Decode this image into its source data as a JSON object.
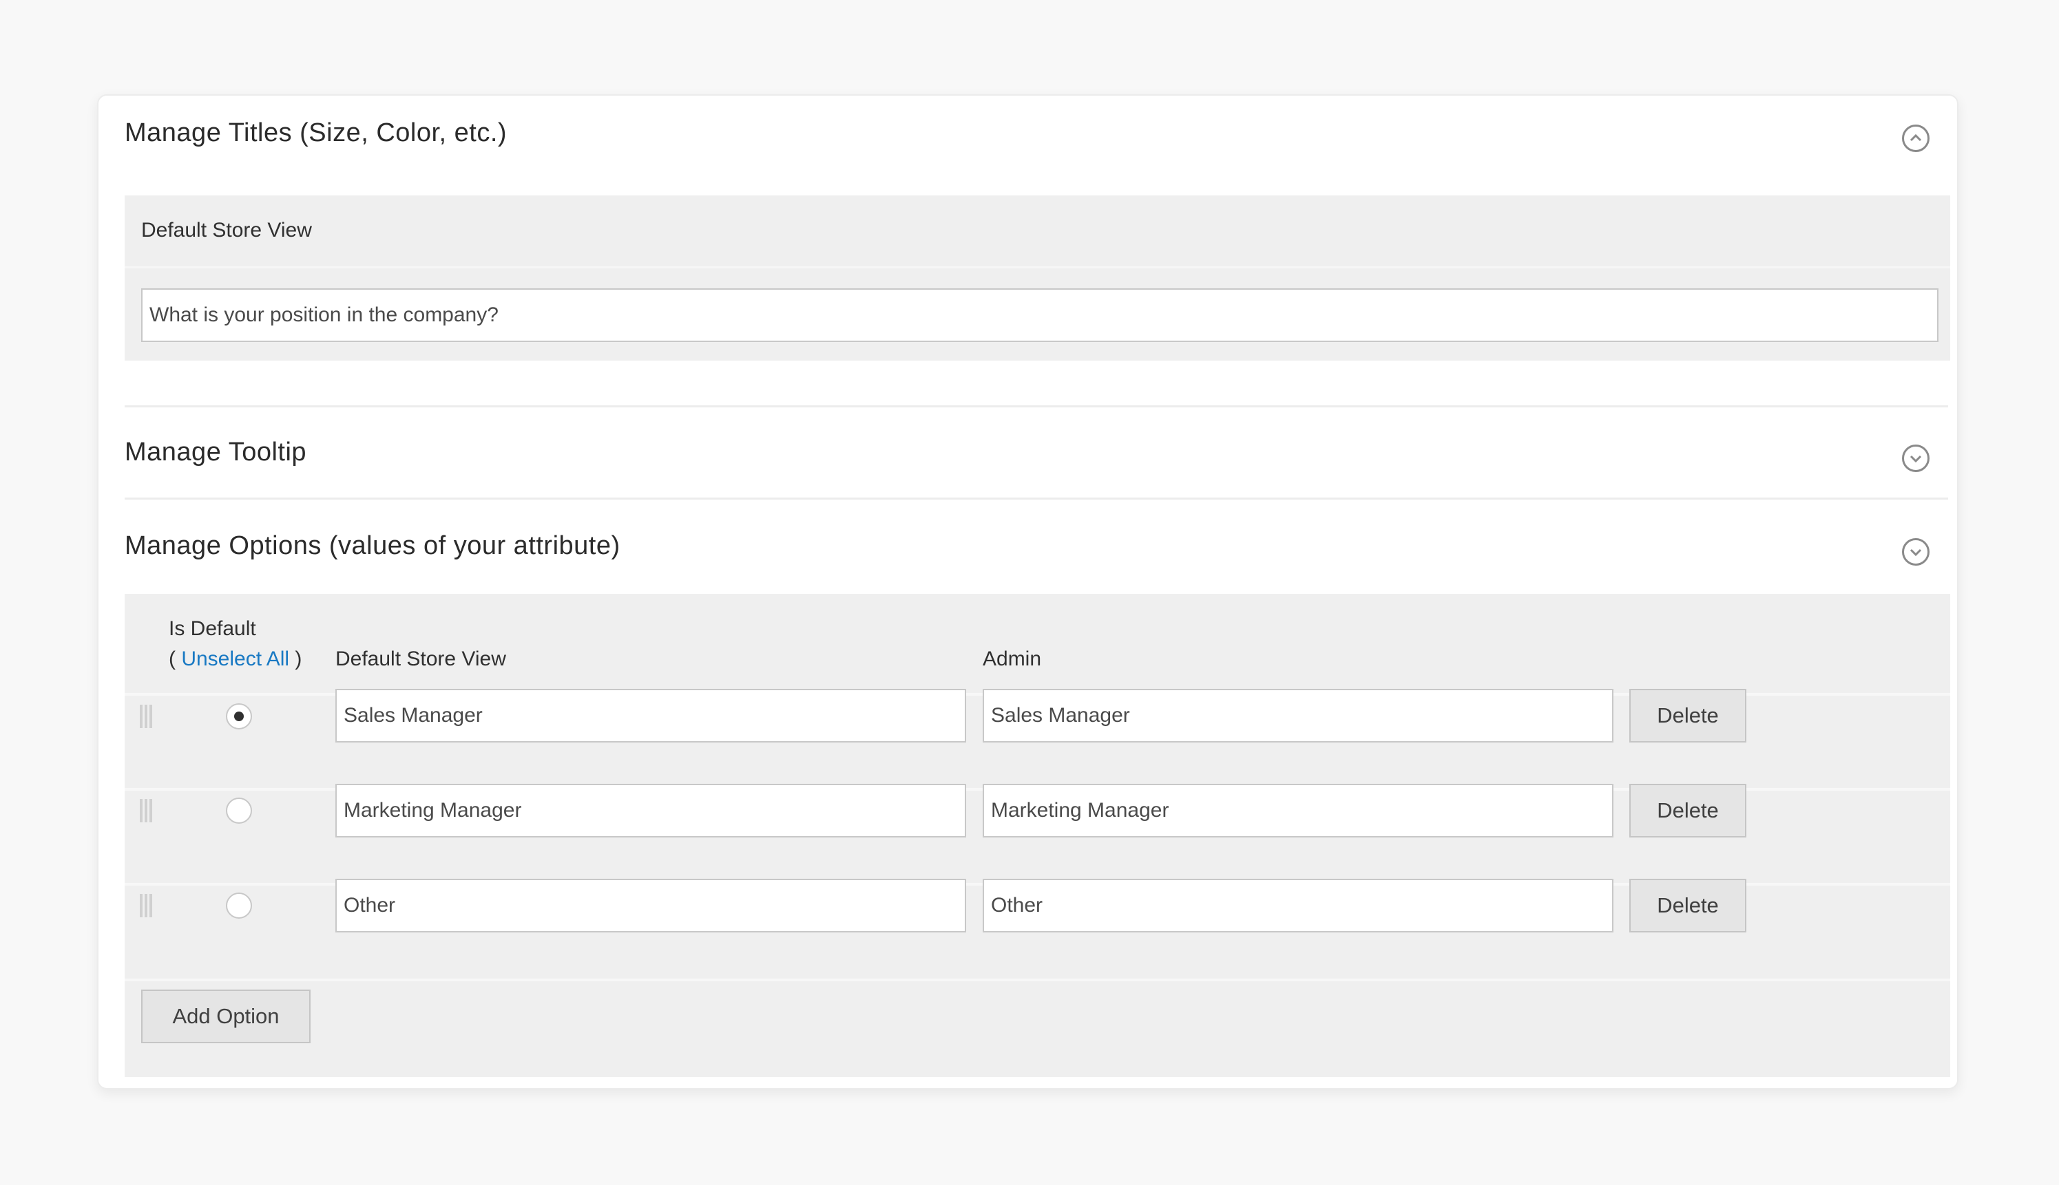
{
  "titles_section": {
    "heading": "Manage Titles (Size, Color, etc.)",
    "store_view_label": "Default Store View",
    "title_value": "What is your position in the company?"
  },
  "tooltip_section": {
    "heading": "Manage Tooltip"
  },
  "options_section": {
    "heading": "Manage Options (values of your attribute)",
    "headers": {
      "is_default": "Is Default",
      "unselect_open": "( ",
      "unselect_link": "Unselect All",
      "unselect_close": " )",
      "store_view": "Default Store View",
      "admin": "Admin"
    },
    "rows": [
      {
        "is_default": true,
        "store_view": "Sales Manager",
        "admin": "Sales Manager",
        "delete_label": "Delete"
      },
      {
        "is_default": false,
        "store_view": "Marketing Manager",
        "admin": "Marketing Manager",
        "delete_label": "Delete"
      },
      {
        "is_default": false,
        "store_view": "Other",
        "admin": "Other",
        "delete_label": "Delete"
      }
    ],
    "add_option_label": "Add Option"
  },
  "icons": {
    "titles_toggle": "chevron-up-circle-icon",
    "tooltip_toggle": "chevron-down-circle-icon",
    "options_toggle": "chevron-down-circle-icon",
    "drag_handle": "drag-handle-icon"
  },
  "colors": {
    "link": "#1979c3",
    "panel_bg": "#efefef",
    "button_bg": "#e5e5e5"
  }
}
